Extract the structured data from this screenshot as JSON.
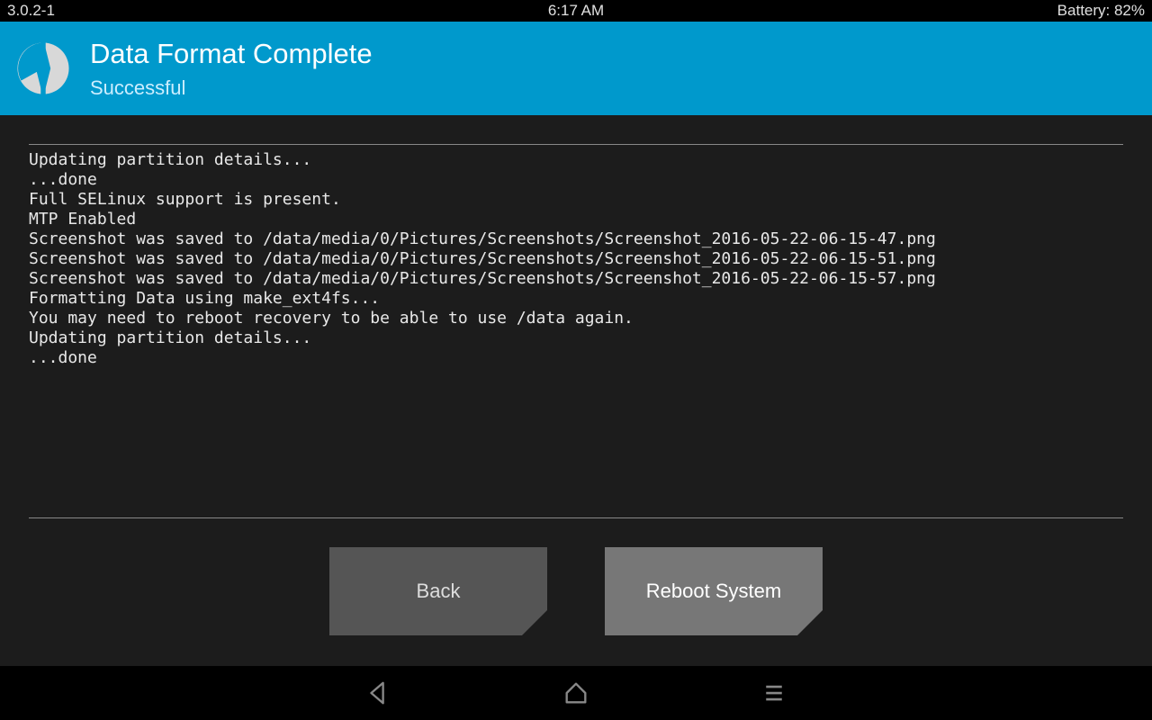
{
  "statusbar": {
    "version": "3.0.2-1",
    "time": "6:17 AM",
    "battery": "Battery: 82%"
  },
  "header": {
    "title": "Data Format Complete",
    "subtitle": "Successful"
  },
  "log_lines": [
    "Updating partition details...",
    "...done",
    "Full SELinux support is present.",
    "MTP Enabled",
    "Screenshot was saved to /data/media/0/Pictures/Screenshots/Screenshot_2016-05-22-06-15-47.png",
    "Screenshot was saved to /data/media/0/Pictures/Screenshots/Screenshot_2016-05-22-06-15-51.png",
    "Screenshot was saved to /data/media/0/Pictures/Screenshots/Screenshot_2016-05-22-06-15-57.png",
    "Formatting Data using make_ext4fs...",
    "You may need to reboot recovery to be able to use /data again.",
    "Updating partition details...",
    "...done"
  ],
  "buttons": {
    "back": "Back",
    "reboot": "Reboot System"
  },
  "colors": {
    "accent": "#0099cc",
    "bg_main": "#1c1c1c",
    "btn": "#555555",
    "btn_primary": "#777777"
  }
}
